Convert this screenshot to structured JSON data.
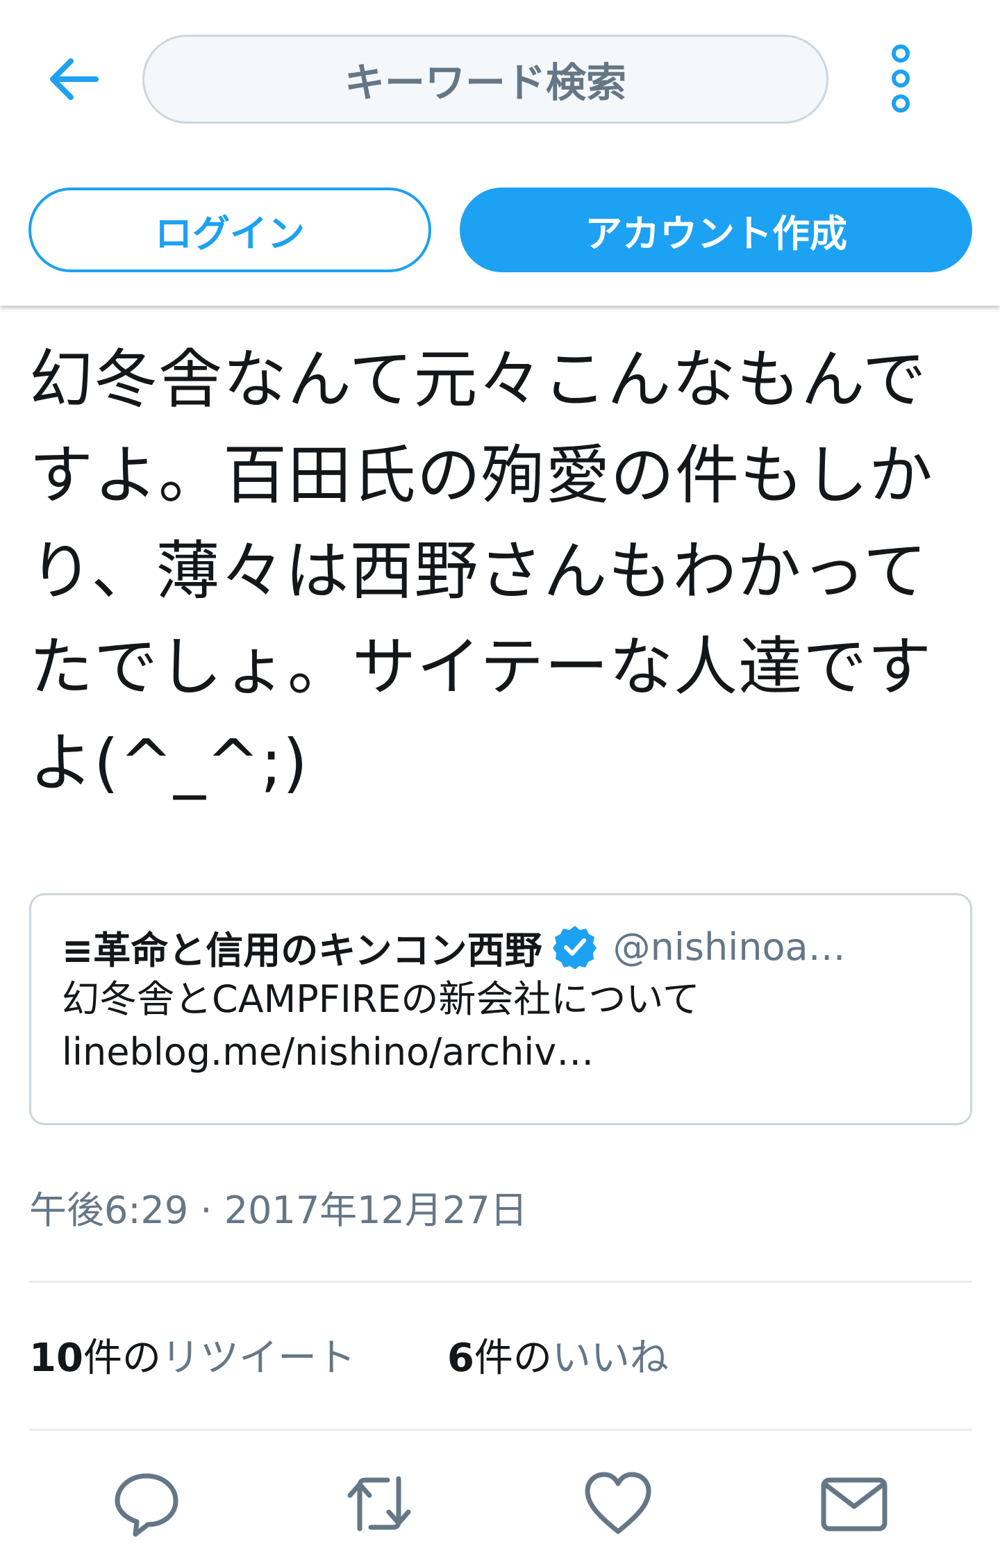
{
  "colors": {
    "accent": "#1da1f2",
    "text": "#14171a",
    "muted": "#657786",
    "border": "#ccd6dd",
    "verified": "#1da1f2"
  },
  "header": {
    "back_icon": "back-arrow-icon",
    "search_placeholder": "キーワード検索",
    "more_icon": "more-vertical-icon",
    "login_label": "ログイン",
    "signup_label": "アカウント作成"
  },
  "tweet": {
    "text": "幻冬舎なんて元々こんなもんですよ。百田氏の殉愛の件もしかり、薄々は西野さんもわかってたでしょ。サイテーな人達ですよ(^_^;)",
    "quote": {
      "name": "≡革命と信用のキンコン西野",
      "verified_icon": "verified-badge-icon",
      "handle": "@nishinoa…",
      "text": "幻冬舎とCAMPFIREの新会社について",
      "link": "lineblog.me/nishino/archiv…"
    },
    "timestamp": "午後6:29 · 2017年12月27日",
    "stats": {
      "retweets_count": "10",
      "retweets_unit": "件の",
      "retweets_label": "リツイート",
      "likes_count": "6",
      "likes_unit": "件の",
      "likes_label": "いいね"
    },
    "actions": [
      "reply-icon",
      "retweet-icon",
      "like-icon",
      "share-icon"
    ]
  }
}
